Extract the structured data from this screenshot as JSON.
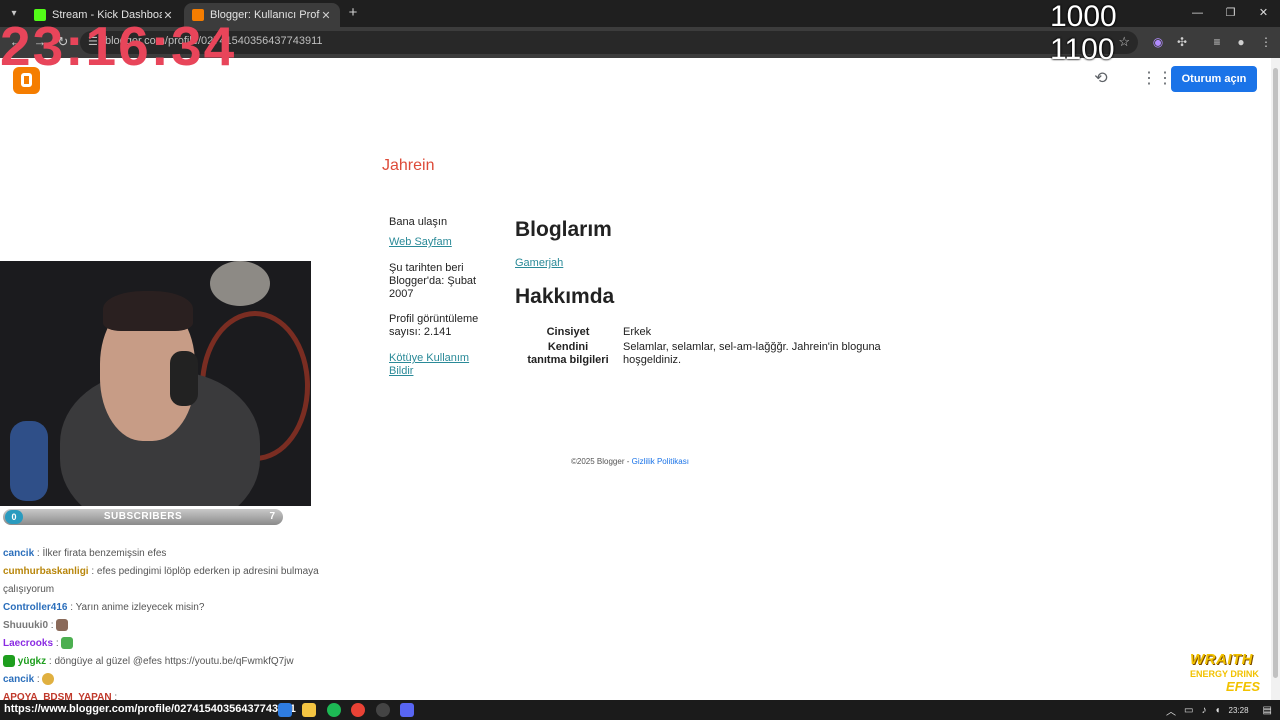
{
  "browser": {
    "tabs": [
      {
        "title": "Stream - Kick Dashboard",
        "favicon_color": "#53fc18"
      },
      {
        "title": "Blogger: Kullanıcı Profili: Jahrein",
        "favicon_color": "#f57d00"
      }
    ],
    "url": "blogger.com/profile/02741540356437743911"
  },
  "overlay": {
    "clock": "23:16:34",
    "counter_top": "1000",
    "counter_bottom": "1100"
  },
  "header": {
    "signin_label": "Oturum açın"
  },
  "profile": {
    "name": "Jahrein",
    "sidebar": {
      "contact_label": "Bana ulaşın",
      "website_link": "Web Sayfam",
      "since_text": "Şu tarihten beri Blogger'da: Şubat 2007",
      "views_text": "Profil görüntüleme sayısı: 2.141",
      "report_link": "Kötüye Kullanım Bildir"
    },
    "blogs_heading": "Bloglarım",
    "blogs": [
      "Gamerjah"
    ],
    "about_heading": "Hakkımda",
    "about": {
      "gender_label": "Cinsiyet",
      "gender_value": "Erkek",
      "intro_label": "Kendini tanıtma bilgileri",
      "intro_value": "Selamlar, selamlar, sel-am-lağğğr. Jahrein'in bloguna hoşgeldiniz."
    }
  },
  "footer": {
    "copyright": "©2025 Blogger -",
    "privacy_link": "Gizlilik Politikası"
  },
  "stream": {
    "subscribers_label": "SUBSCRIBERS",
    "subscribers_current": "0",
    "subscribers_goal": "7",
    "chat": [
      {
        "user": "cancik",
        "user_color": "#2a6ebb",
        "text": ": İlker firata benzemişsin efes"
      },
      {
        "user": "cumhurbaskanligi",
        "user_color": "#b8860b",
        "text": ": efes pedingimi löplöp ederken ip adresini bulmaya çalışıyorum"
      },
      {
        "user": "Controller416",
        "user_color": "#2a6ebb",
        "text": ": Yarın anime izleyecek misin?"
      },
      {
        "user": "Shuuuki0",
        "user_color": "#777777",
        "text": ":"
      },
      {
        "user": "Laecrooks",
        "user_color": "#8a2be2",
        "text": ":"
      },
      {
        "user": "yügkz",
        "user_color": "#1e9e1e",
        "text": ": döngüye al güzel @efes https://youtu.be/qFwmkfQ7jw"
      },
      {
        "user": "cancik",
        "user_color": "#2a6ebb",
        "text": ":"
      },
      {
        "user": "APOYA_BDSM_YAPAN",
        "user_color": "#c0392b",
        "text": ":"
      }
    ],
    "sponsor": {
      "line1": "WRAITH",
      "line2": "ENERGY DRINK",
      "line3": "EFES"
    }
  },
  "status": {
    "hover_url": "https://www.blogger.com/profile/02741540356437743911",
    "time": "23:28"
  }
}
